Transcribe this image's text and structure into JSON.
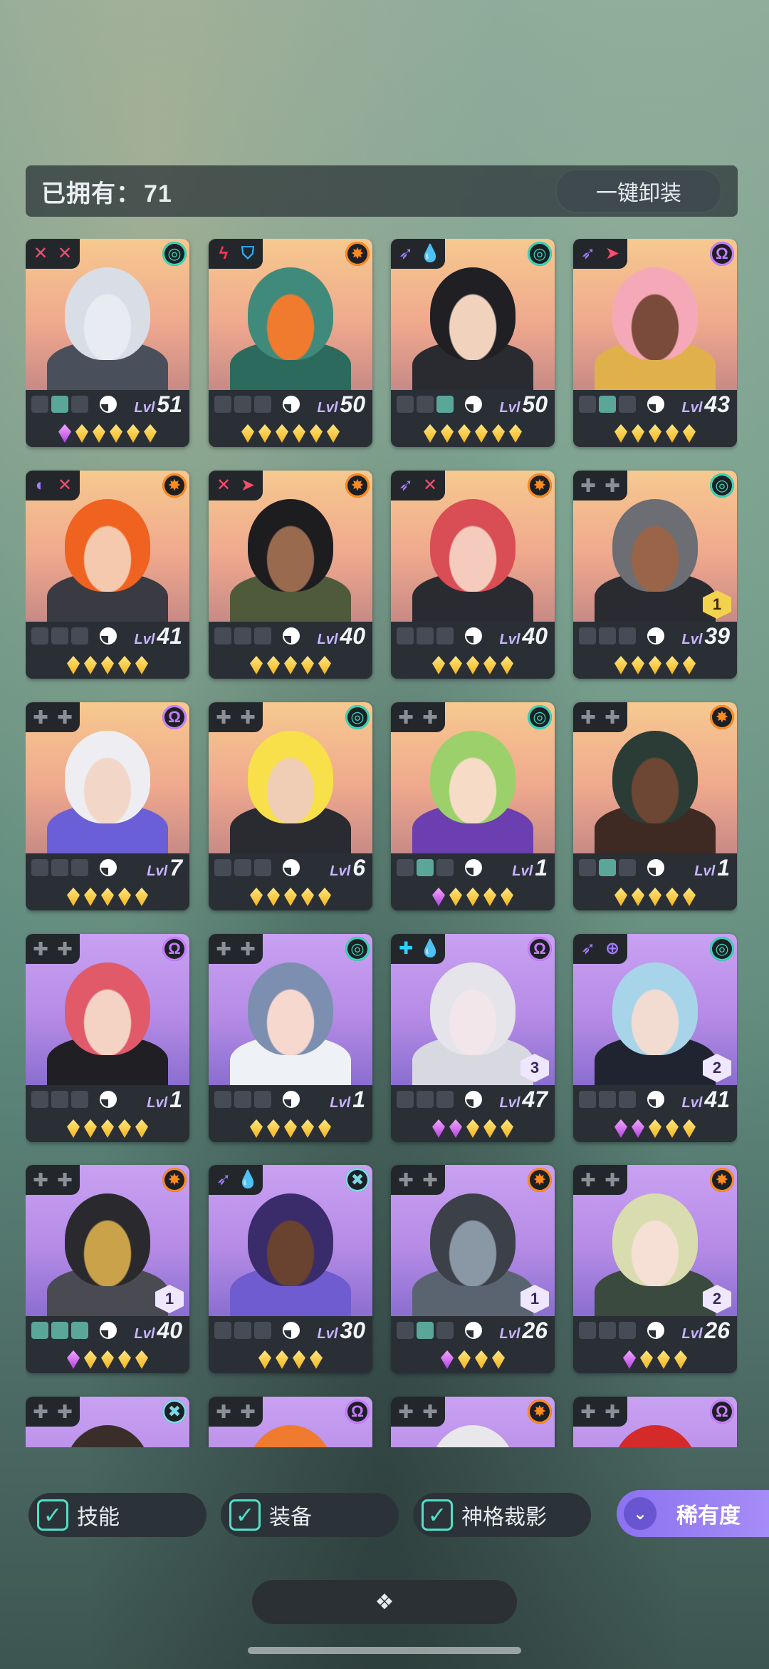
{
  "header": {
    "owned_label": "已拥有：",
    "owned_count": "71",
    "unequip_all_label": "一键卸装"
  },
  "lvl_label": "Lvl",
  "colors": {
    "accent_check": "#4fe0c7",
    "rarity_button": "#9b80f3",
    "gold_gem": "#f2b51c",
    "purple_gem": "#b243e0"
  },
  "cards": [
    {
      "bg": "peach",
      "tags": [
        {
          "g": "✕",
          "c": "#ff4b6e"
        },
        {
          "g": "✕",
          "c": "#ff4b6e"
        }
      ],
      "faction": {
        "g": "◎",
        "c": "#36d6b8"
      },
      "slots": [
        0,
        1,
        0
      ],
      "level": "51",
      "gems": [
        "purple",
        "gold",
        "gold",
        "gold",
        "gold",
        "gold"
      ],
      "rank": "",
      "hair": "#d9dde6",
      "skin": "#e8ecf2",
      "cloth": "#4a4f5c"
    },
    {
      "bg": "peach",
      "tags": [
        {
          "g": "ϟ",
          "c": "#ff3355"
        },
        {
          "g": "⛉",
          "c": "#2ab7ff"
        }
      ],
      "faction": {
        "g": "✸",
        "c": "#ff8a1f"
      },
      "slots": [
        0,
        0,
        0
      ],
      "level": "50",
      "gems": [
        "gold",
        "gold",
        "gold",
        "gold",
        "gold",
        "gold"
      ],
      "rank": "",
      "hair": "#3f8a7b",
      "skin": "#f07a2e",
      "cloth": "#2c6a5e"
    },
    {
      "bg": "peach",
      "tags": [
        {
          "g": "➶",
          "c": "#a57cff"
        },
        {
          "g": "💧",
          "c": "#2ab7ff"
        }
      ],
      "faction": {
        "g": "◎",
        "c": "#36d6b8"
      },
      "slots": [
        0,
        0,
        1
      ],
      "level": "50",
      "gems": [
        "gold",
        "gold",
        "gold",
        "gold",
        "gold",
        "gold"
      ],
      "rank": "",
      "hair": "#1f1f24",
      "skin": "#f1d2bd",
      "cloth": "#2a2a31"
    },
    {
      "bg": "peach",
      "tags": [
        {
          "g": "➶",
          "c": "#a57cff"
        },
        {
          "g": "➤",
          "c": "#ff4b6e"
        }
      ],
      "faction": {
        "g": "Ω",
        "c": "#c77dff"
      },
      "slots": [
        0,
        1,
        0
      ],
      "level": "43",
      "gems": [
        "gold",
        "gold",
        "gold",
        "gold",
        "gold"
      ],
      "rank": "",
      "hair": "#f5a9b8",
      "skin": "#7a4a3a",
      "cloth": "#e0b14a"
    },
    {
      "bg": "peach",
      "tags": [
        {
          "g": "◐",
          "c": "#a57cff"
        },
        {
          "g": "✕",
          "c": "#ff4b6e"
        }
      ],
      "faction": {
        "g": "✸",
        "c": "#ff8a1f"
      },
      "slots": [
        0,
        0,
        0
      ],
      "level": "41",
      "gems": [
        "gold",
        "gold",
        "gold",
        "gold",
        "gold"
      ],
      "rank": "",
      "hair": "#f0621f",
      "skin": "#f4c9ae",
      "cloth": "#3a3a42"
    },
    {
      "bg": "peach",
      "tags": [
        {
          "g": "✕",
          "c": "#ff4b6e"
        },
        {
          "g": "➤",
          "c": "#ff4b6e"
        }
      ],
      "faction": {
        "g": "✸",
        "c": "#ff8a1f"
      },
      "slots": [
        0,
        0,
        0
      ],
      "level": "40",
      "gems": [
        "gold",
        "gold",
        "gold",
        "gold",
        "gold"
      ],
      "rank": "",
      "hair": "#1d1d20",
      "skin": "#9a6a4e",
      "cloth": "#4f5a3a"
    },
    {
      "bg": "peach",
      "tags": [
        {
          "g": "➶",
          "c": "#a57cff"
        },
        {
          "g": "✕",
          "c": "#ff4b6e"
        }
      ],
      "faction": {
        "g": "✸",
        "c": "#ff8a1f"
      },
      "slots": [
        0,
        0,
        0
      ],
      "level": "40",
      "gems": [
        "gold",
        "gold",
        "gold",
        "gold",
        "gold"
      ],
      "rank": "",
      "hair": "#d94d55",
      "skin": "#f4cbbd",
      "cloth": "#2a2a31"
    },
    {
      "bg": "peach",
      "tags": [
        {
          "g": "✚",
          "c": "#8a9096"
        },
        {
          "g": "✚",
          "c": "#8a9096"
        }
      ],
      "faction": {
        "g": "◎",
        "c": "#36d6b8"
      },
      "slots": [
        0,
        0,
        0
      ],
      "level": "39",
      "gems": [
        "gold",
        "gold",
        "gold",
        "gold",
        "gold"
      ],
      "rank": "1",
      "rankStyle": "gold",
      "hair": "#6d6d74",
      "skin": "#9a6448",
      "cloth": "#2a2a31"
    },
    {
      "bg": "peach",
      "tags": [
        {
          "g": "✚",
          "c": "#8a9096"
        },
        {
          "g": "✚",
          "c": "#8a9096"
        }
      ],
      "faction": {
        "g": "Ω",
        "c": "#c77dff"
      },
      "slots": [
        0,
        0,
        0
      ],
      "level": "7",
      "gems": [
        "gold",
        "gold",
        "gold",
        "gold",
        "gold"
      ],
      "rank": "",
      "hair": "#eeeef2",
      "skin": "#f2d6c8",
      "cloth": "#6a5fd6"
    },
    {
      "bg": "peach",
      "tags": [
        {
          "g": "✚",
          "c": "#8a9096"
        },
        {
          "g": "✚",
          "c": "#8a9096"
        }
      ],
      "faction": {
        "g": "◎",
        "c": "#36d6b8"
      },
      "slots": [
        0,
        0,
        0
      ],
      "level": "6",
      "gems": [
        "gold",
        "gold",
        "gold",
        "gold",
        "gold"
      ],
      "rank": "",
      "hair": "#f7e04a",
      "skin": "#f0cdb5",
      "cloth": "#2a2a31"
    },
    {
      "bg": "peach",
      "tags": [
        {
          "g": "✚",
          "c": "#8a9096"
        },
        {
          "g": "✚",
          "c": "#8a9096"
        }
      ],
      "faction": {
        "g": "◎",
        "c": "#36d6b8"
      },
      "slots": [
        0,
        1,
        0
      ],
      "level": "1",
      "gems": [
        "purple",
        "gold",
        "gold",
        "gold",
        "gold"
      ],
      "rank": "",
      "hair": "#9bd06a",
      "skin": "#f6dcc6",
      "cloth": "#6b3fb0"
    },
    {
      "bg": "peach",
      "tags": [
        {
          "g": "✚",
          "c": "#8a9096"
        },
        {
          "g": "✚",
          "c": "#8a9096"
        }
      ],
      "faction": {
        "g": "✸",
        "c": "#ff8a1f"
      },
      "slots": [
        0,
        1,
        0
      ],
      "level": "1",
      "gems": [
        "gold",
        "gold",
        "gold",
        "gold",
        "gold"
      ],
      "rank": "",
      "hair": "#2b3c36",
      "skin": "#6e4634",
      "cloth": "#3e2a22"
    },
    {
      "bg": "violet",
      "tags": [
        {
          "g": "✚",
          "c": "#8a9096"
        },
        {
          "g": "✚",
          "c": "#8a9096"
        }
      ],
      "faction": {
        "g": "Ω",
        "c": "#c77dff"
      },
      "slots": [
        0,
        0,
        0
      ],
      "level": "1",
      "gems": [
        "gold",
        "gold",
        "gold",
        "gold",
        "gold"
      ],
      "rank": "",
      "hair": "#e05a6a",
      "skin": "#f4d2c4",
      "cloth": "#1f1f24"
    },
    {
      "bg": "violet",
      "tags": [
        {
          "g": "✚",
          "c": "#8a9096"
        },
        {
          "g": "✚",
          "c": "#8a9096"
        }
      ],
      "faction": {
        "g": "◎",
        "c": "#36d6b8"
      },
      "slots": [
        0,
        0,
        0
      ],
      "level": "1",
      "gems": [
        "gold",
        "gold",
        "gold",
        "gold",
        "gold"
      ],
      "rank": "",
      "hair": "#7d8fb0",
      "skin": "#f6d8ce",
      "cloth": "#eef2f6"
    },
    {
      "bg": "violet",
      "tags": [
        {
          "g": "✚",
          "c": "#2ad4ff"
        },
        {
          "g": "💧",
          "c": "#2ab7ff"
        }
      ],
      "faction": {
        "g": "Ω",
        "c": "#c77dff"
      },
      "slots": [
        0,
        0,
        0
      ],
      "level": "47",
      "gems": [
        "purple",
        "purple",
        "gold",
        "gold",
        "gold"
      ],
      "rank": "3",
      "rankStyle": "",
      "hair": "#e4e4ea",
      "skin": "#f2e6ea",
      "cloth": "#d8d8e0"
    },
    {
      "bg": "violet",
      "tags": [
        {
          "g": "➶",
          "c": "#a57cff"
        },
        {
          "g": "⊕",
          "c": "#a57cff"
        }
      ],
      "faction": {
        "g": "◎",
        "c": "#36d6b8"
      },
      "slots": [
        0,
        0,
        0
      ],
      "level": "41",
      "gems": [
        "purple",
        "purple",
        "gold",
        "gold",
        "gold"
      ],
      "rank": "2",
      "rankStyle": "",
      "hair": "#a8d4ea",
      "skin": "#f2dcd2",
      "cloth": "#1f2430"
    },
    {
      "bg": "violet",
      "tags": [
        {
          "g": "✚",
          "c": "#8a9096"
        },
        {
          "g": "✚",
          "c": "#8a9096"
        }
      ],
      "faction": {
        "g": "✸",
        "c": "#ff8a1f"
      },
      "slots": [
        1,
        1,
        1
      ],
      "level": "40",
      "gems": [
        "purple",
        "gold",
        "gold",
        "gold",
        "gold"
      ],
      "rank": "1",
      "rankStyle": "",
      "hair": "#2a2a2e",
      "skin": "#c9a24a",
      "cloth": "#4a4a52"
    },
    {
      "bg": "violet",
      "tags": [
        {
          "g": "➶",
          "c": "#a57cff"
        },
        {
          "g": "💧",
          "c": "#2ab7ff"
        }
      ],
      "faction": {
        "g": "✖",
        "c": "#7fd8e6"
      },
      "slots": [
        0,
        0,
        0
      ],
      "level": "30",
      "gems": [
        "gold",
        "gold",
        "gold",
        "gold"
      ],
      "rank": "",
      "hair": "#3a2b6a",
      "skin": "#6a4230",
      "cloth": "#6f5cd0"
    },
    {
      "bg": "violet",
      "tags": [
        {
          "g": "✚",
          "c": "#8a9096"
        },
        {
          "g": "✚",
          "c": "#8a9096"
        }
      ],
      "faction": {
        "g": "✸",
        "c": "#ff8a1f"
      },
      "slots": [
        0,
        1,
        0
      ],
      "level": "26",
      "gems": [
        "purple",
        "gold",
        "gold",
        "gold"
      ],
      "rank": "1",
      "rankStyle": "",
      "hair": "#3c4048",
      "skin": "#8a98a6",
      "cloth": "#5a6470"
    },
    {
      "bg": "violet",
      "tags": [
        {
          "g": "✚",
          "c": "#8a9096"
        },
        {
          "g": "✚",
          "c": "#8a9096"
        }
      ],
      "faction": {
        "g": "✸",
        "c": "#ff8a1f"
      },
      "slots": [
        0,
        0,
        0
      ],
      "level": "26",
      "gems": [
        "purple",
        "gold",
        "gold",
        "gold"
      ],
      "rank": "2",
      "rankStyle": "",
      "hair": "#d8dcae",
      "skin": "#f6e0d6",
      "cloth": "#3a4a3e"
    },
    {
      "bg": "violet",
      "tags": [
        {
          "g": "✚",
          "c": "#8a9096"
        },
        {
          "g": "✚",
          "c": "#8a9096"
        }
      ],
      "faction": {
        "g": "✖",
        "c": "#7fd8e6"
      },
      "slots": [
        0,
        0,
        0
      ],
      "level": "",
      "gems": [],
      "rank": "",
      "hair": "#3a2e2a",
      "skin": "#eeeeee",
      "cloth": "#2a2a31"
    },
    {
      "bg": "violet",
      "tags": [
        {
          "g": "✚",
          "c": "#8a9096"
        },
        {
          "g": "✚",
          "c": "#8a9096"
        }
      ],
      "faction": {
        "g": "Ω",
        "c": "#c77dff"
      },
      "slots": [
        0,
        0,
        0
      ],
      "level": "",
      "gems": [],
      "rank": "",
      "hair": "#f07a2e",
      "skin": "#f4d0b8",
      "cloth": "#2a2a31"
    },
    {
      "bg": "violet",
      "tags": [
        {
          "g": "✚",
          "c": "#8a9096"
        },
        {
          "g": "✚",
          "c": "#8a9096"
        }
      ],
      "faction": {
        "g": "✸",
        "c": "#ff8a1f"
      },
      "slots": [
        0,
        0,
        0
      ],
      "level": "",
      "gems": [],
      "rank": "",
      "hair": "#e8e8ec",
      "skin": "#2a2a31",
      "cloth": "#2a2a31"
    },
    {
      "bg": "violet",
      "tags": [
        {
          "g": "✚",
          "c": "#8a9096"
        },
        {
          "g": "✚",
          "c": "#8a9096"
        }
      ],
      "faction": {
        "g": "Ω",
        "c": "#c77dff"
      },
      "slots": [
        0,
        0,
        0
      ],
      "level": "",
      "gems": [],
      "rank": "",
      "hair": "#d42a2a",
      "skin": "#2a2a31",
      "cloth": "#2a2a31"
    }
  ],
  "filters": [
    {
      "label": "技能",
      "checked": true
    },
    {
      "label": "装备",
      "checked": true
    },
    {
      "label": "神格裁影",
      "checked": true
    }
  ],
  "rarity": {
    "label": "稀有度",
    "icon": "chevron-double-down-icon"
  },
  "bottom_pill": {
    "icon": "diamond-cluster-icon",
    "glyph": "❖"
  }
}
